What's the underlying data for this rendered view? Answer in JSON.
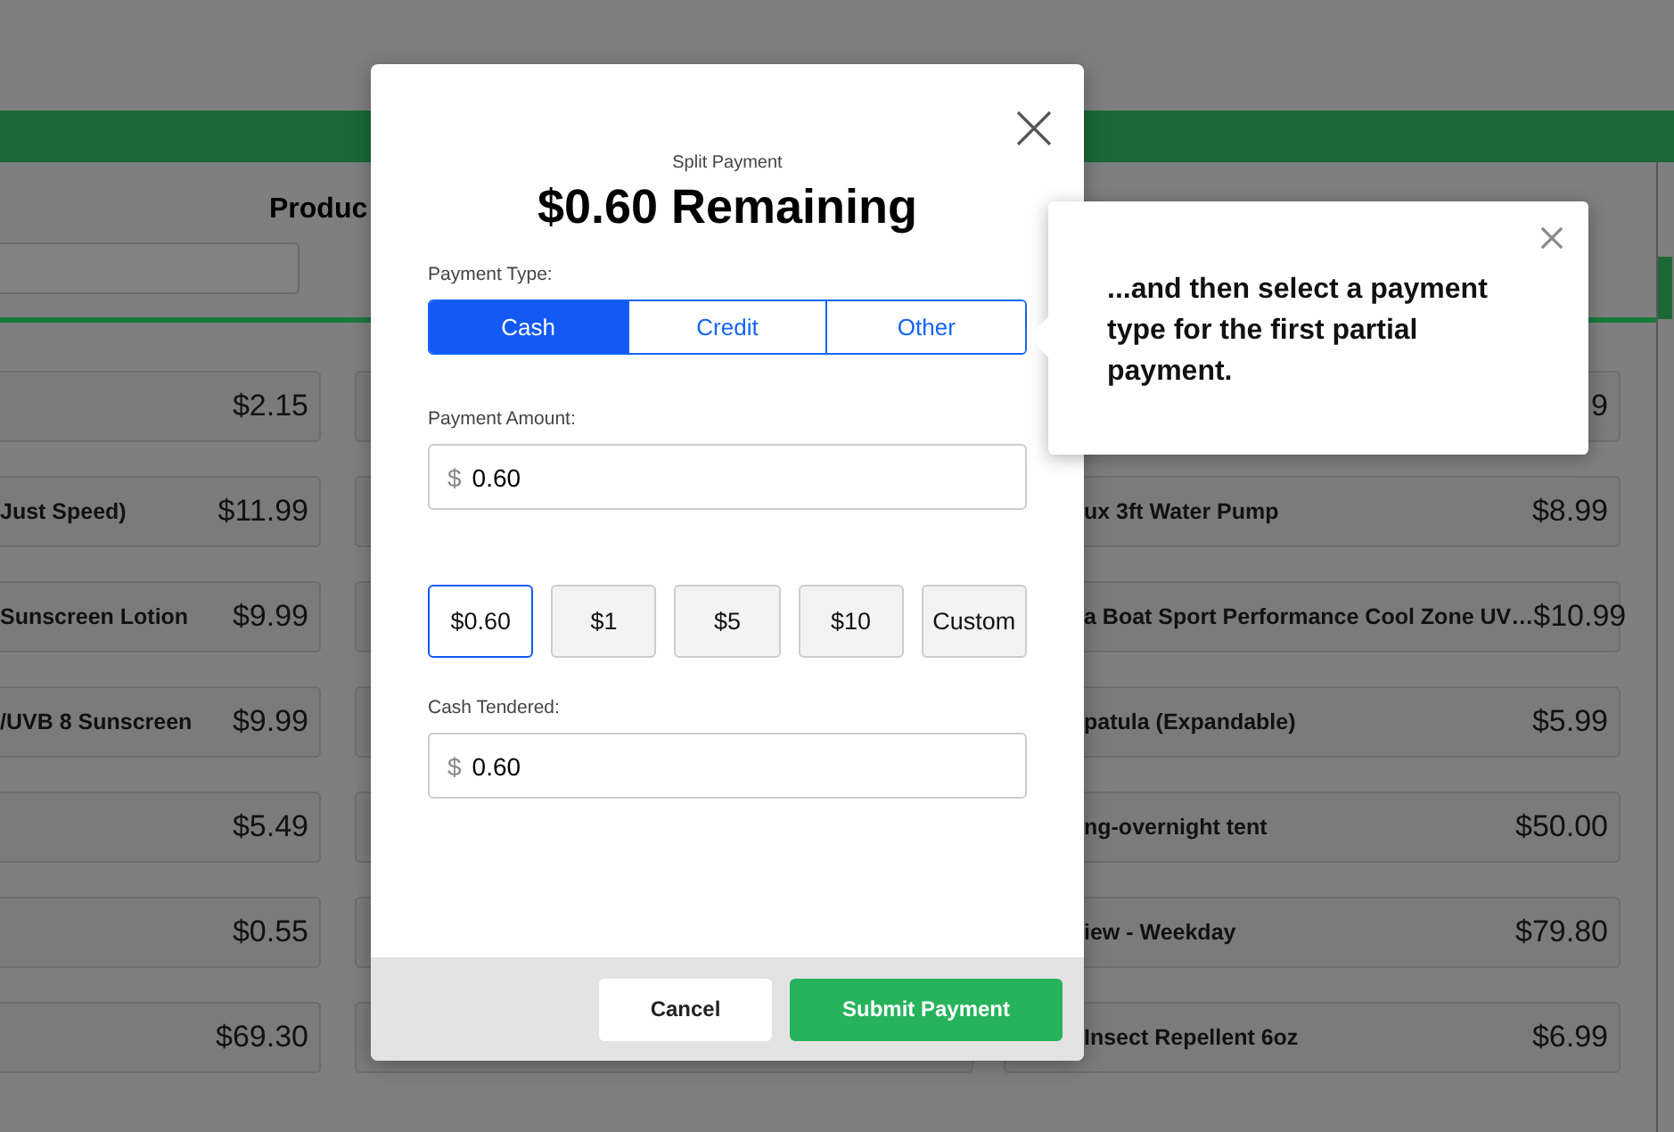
{
  "background": {
    "heading": "Produc",
    "left_products": [
      {
        "price": "$2.15"
      },
      {
        "name": "Just Speed)",
        "price": "$11.99"
      },
      {
        "name": "Sunscreen Lotion",
        "price": "$9.99"
      },
      {
        "name": "/UVB 8 Sunscreen",
        "price": "$9.99"
      },
      {
        "price": "$5.49"
      },
      {
        "price": "$0.55"
      },
      {
        "price": "$69.30"
      }
    ],
    "right_products": [
      {
        "price": "9"
      },
      {
        "name": "ux 3ft Water Pump",
        "price": "$8.99"
      },
      {
        "name": "a Boat Sport Performance Cool Zone UV…",
        "price": "$10.99"
      },
      {
        "name": "patula (Expandable)",
        "price": "$5.99"
      },
      {
        "name": "ng-overnight tent",
        "price": "$50.00"
      },
      {
        "name": "iew - Weekday",
        "price": "$79.80"
      },
      {
        "name": "Insect Repellent 6oz",
        "price": "$6.99"
      }
    ]
  },
  "modal": {
    "subtitle": "Split Payment",
    "title": "$0.60 Remaining",
    "payment_type_label": "Payment Type:",
    "payment_types": [
      {
        "label": "Cash",
        "selected": true
      },
      {
        "label": "Credit",
        "selected": false
      },
      {
        "label": "Other",
        "selected": false
      }
    ],
    "payment_amount": {
      "label": "Payment Amount:",
      "currency": "$",
      "value": "0.60"
    },
    "quick_amounts": [
      {
        "label": "$0.60",
        "selected": true
      },
      {
        "label": "$1",
        "selected": false
      },
      {
        "label": "$5",
        "selected": false
      },
      {
        "label": "$10",
        "selected": false
      },
      {
        "label": "Custom",
        "selected": false
      }
    ],
    "cash_tendered": {
      "label": "Cash Tendered:",
      "currency": "$",
      "value": "0.60"
    },
    "buttons": [
      {
        "label": "Cancel",
        "kind": "secondary"
      },
      {
        "label": "Submit Payment",
        "kind": "primary"
      }
    ]
  },
  "tooltip": {
    "text": "...and then select a payment type for the first partial payment."
  }
}
